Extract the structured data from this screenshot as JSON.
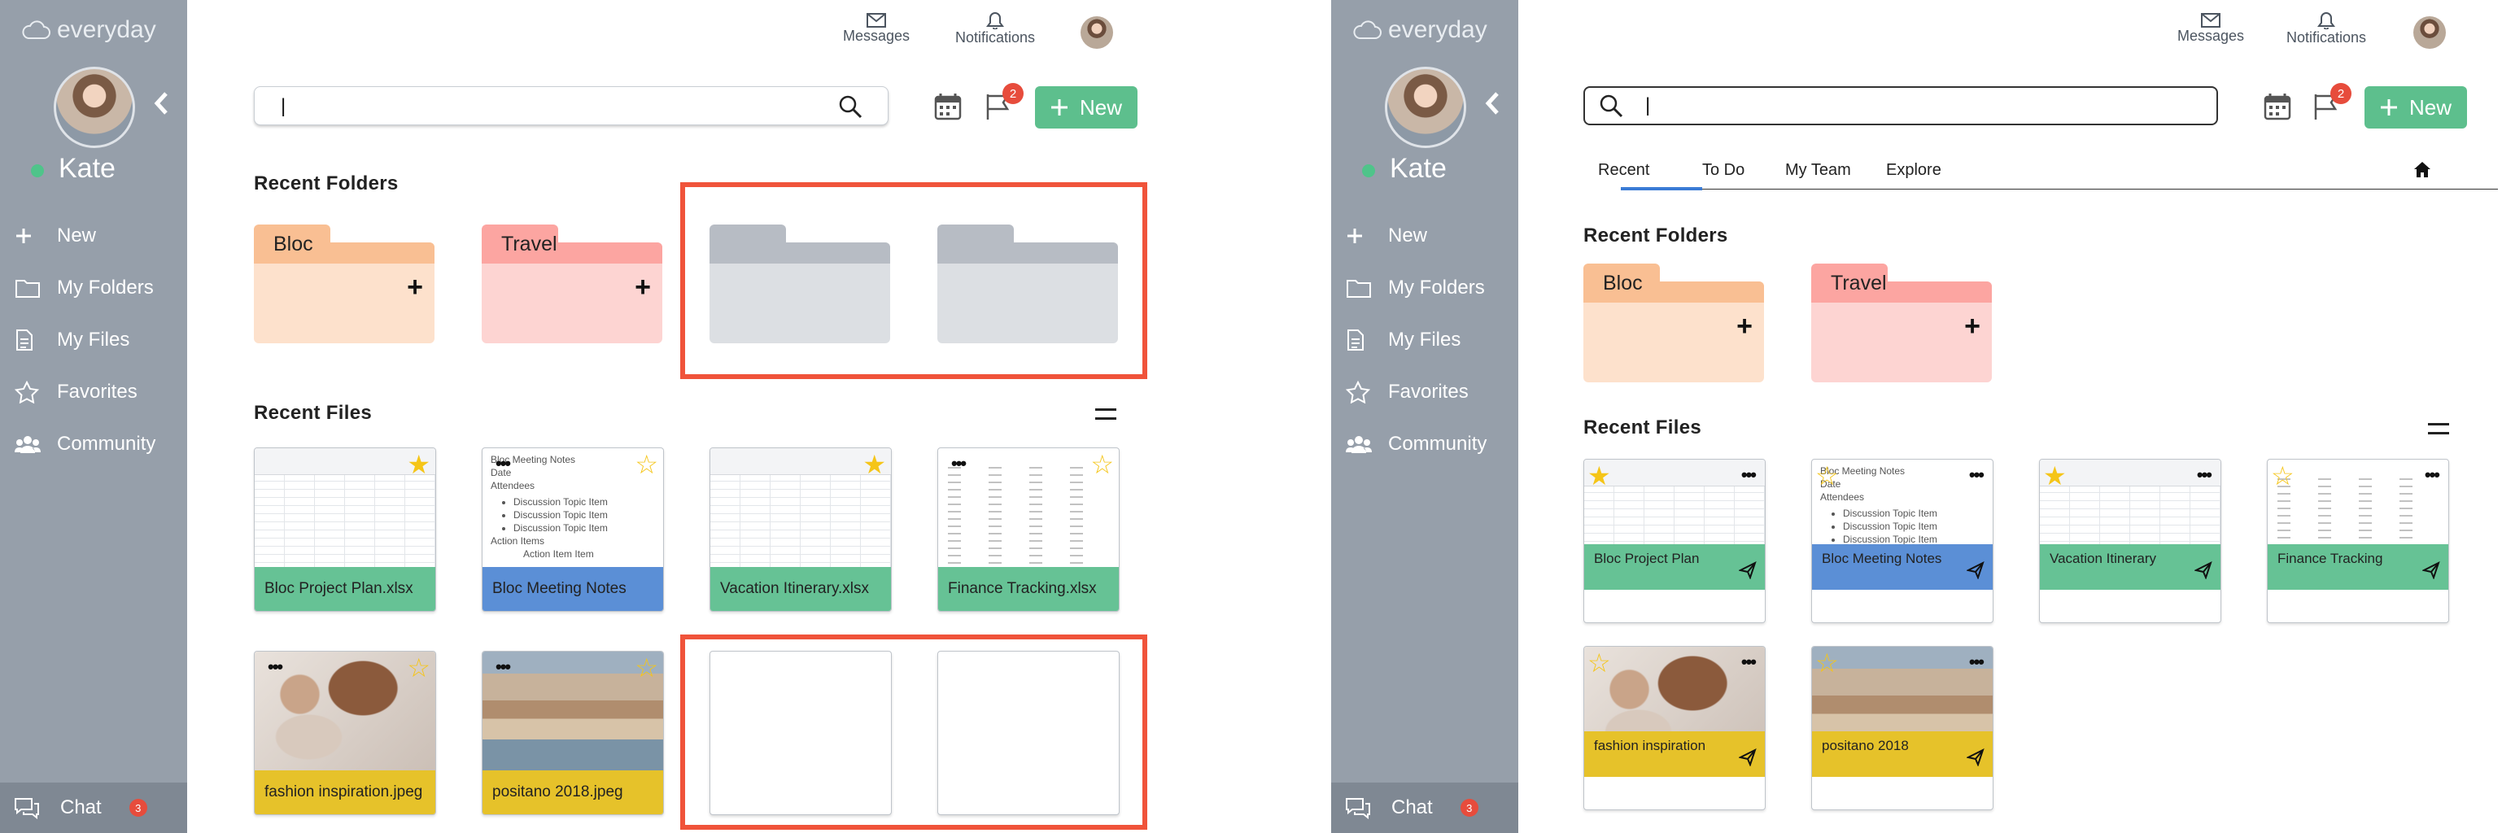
{
  "app": {
    "name": "everyday"
  },
  "user": {
    "name": "Kate"
  },
  "sidebar": {
    "items": [
      {
        "label": "New"
      },
      {
        "label": "My Folders"
      },
      {
        "label": "My Files"
      },
      {
        "label": "Favorites"
      },
      {
        "label": "Community"
      }
    ],
    "chat": {
      "label": "Chat",
      "badge": "3"
    }
  },
  "topbar": {
    "messages": "Messages",
    "notifications": "Notifications",
    "new_label": "New",
    "flag_badge": "2"
  },
  "search": {
    "value": "|"
  },
  "tabs": [
    "Recent",
    "To Do",
    "My Team",
    "Explore"
  ],
  "sections": {
    "recent_folders": "Recent Folders",
    "recent_files": "Recent Files"
  },
  "folders": [
    {
      "name": "Bloc",
      "tab_color": "#f9bf93",
      "body_color": "#fde1cc"
    },
    {
      "name": "Travel",
      "tab_color": "#fca5a1",
      "body_color": "#fdd4d2"
    }
  ],
  "doc_preview": {
    "title": "Bloc Meeting Notes",
    "date": "Date",
    "attendees": "Attendees",
    "items": [
      "Discussion Topic Item",
      "Discussion Topic Item",
      "Discussion Topic Item"
    ],
    "action": "Action Items",
    "action_item": "Action Item Item"
  },
  "files_a": [
    {
      "name": "Bloc Project Plan.xlsx",
      "color": "#66c295",
      "starred": true
    },
    {
      "name": "Bloc Meeting Notes",
      "color": "#5b8fd6",
      "starred": false
    },
    {
      "name": "Vacation Itinerary.xlsx",
      "color": "#66c295",
      "starred": true
    },
    {
      "name": "Finance Tracking.xlsx",
      "color": "#66c295",
      "starred": false
    },
    {
      "name": "fashion inspiration.jpeg",
      "color": "#e6c22a",
      "starred": false
    },
    {
      "name": "positano 2018.jpeg",
      "color": "#e6c22a",
      "starred": false
    }
  ],
  "files_b": [
    {
      "name": "Bloc Project Plan",
      "color": "#66c295",
      "starred": true
    },
    {
      "name": "Bloc Meeting Notes",
      "color": "#5b8fd6",
      "starred": false
    },
    {
      "name": "Vacation Itinerary",
      "color": "#66c295",
      "starred": true
    },
    {
      "name": "Finance Tracking",
      "color": "#66c295",
      "starred": false
    },
    {
      "name": "fashion inspiration",
      "color": "#e6c22a",
      "starred": false
    },
    {
      "name": "positano 2018",
      "color": "#e6c22a",
      "starred": false
    }
  ],
  "colors": {
    "sidebar": "#969faa",
    "accent_green": "#5dbf8d",
    "highlight_red": "#f0533a",
    "active_tab": "#3a7bd5",
    "star": "#f5c518"
  }
}
